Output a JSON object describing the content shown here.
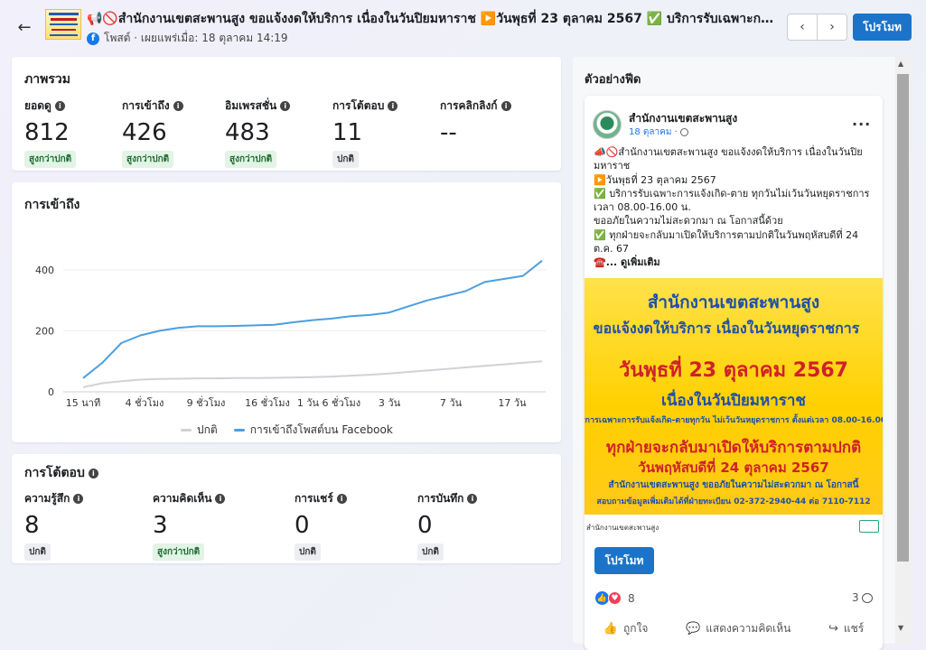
{
  "header": {
    "title": "📢🚫สำนักงานเขตสะพานสูง ขอแจ้งงดให้บริการ เนื่องในวันปิยมหาราช ▶️วันพุธที่ 23 ตุลาคม 2567 ✅ บริการรับเฉพาะการแจ้งเ...",
    "meta": "โพสต์ · เผยแพร่เมื่อ: 18 ตุลาคม 14:19",
    "prev_icon": "‹",
    "next_icon": "›",
    "promote_label": "โปรโมท"
  },
  "overview": {
    "title": "ภาพรวม",
    "metrics": [
      {
        "label": "ยอดดู",
        "value": "812",
        "badge": "สูงกว่าปกติ",
        "info": "i"
      },
      {
        "label": "การเข้าถึง",
        "value": "426",
        "badge": "สูงกว่าปกติ",
        "info": "i"
      },
      {
        "label": "อิมเพรสชั่น",
        "value": "483",
        "badge": "สูงกว่าปกติ",
        "info": "i"
      },
      {
        "label": "การโต้ตอบ",
        "value": "11",
        "badge": "ปกติ",
        "info": "i"
      },
      {
        "label": "การคลิกลิงก์",
        "value": "--",
        "info": "i"
      }
    ]
  },
  "reach": {
    "title": "การเข้าถึง"
  },
  "chart_data": {
    "type": "line",
    "title": "การเข้าถึง",
    "x_tick_labels": [
      "15 นาที",
      "4 ชั่วโมง",
      "9 ชั่วโมง",
      "16 ชั่วโมง",
      "1 วัน 6 ชั่วโมง",
      "3 วัน",
      "7 วัน",
      "17 วัน"
    ],
    "y_ticks": [
      "0",
      "200",
      "400"
    ],
    "ylim": [
      0,
      450
    ],
    "grid": true,
    "legend_placement": "bottom",
    "x": [
      0,
      1,
      2,
      3,
      4,
      5,
      6,
      7,
      8,
      9,
      10,
      11,
      12,
      13,
      14,
      15,
      16,
      17,
      18,
      19,
      20,
      21,
      22,
      23,
      24
    ],
    "series": [
      {
        "name": "ปกติ",
        "color": "#d0d2d6",
        "values": [
          15,
          28,
          35,
          40,
          42,
          43,
          44,
          44,
          45,
          45,
          46,
          47,
          48,
          50,
          53,
          56,
          60,
          65,
          70,
          75,
          80,
          85,
          90,
          95,
          100
        ]
      },
      {
        "name": "การเข้าถึงโพสต์บน Facebook",
        "color": "#4a9fe0",
        "values": [
          45,
          95,
          160,
          185,
          200,
          210,
          215,
          215,
          216,
          218,
          220,
          228,
          235,
          240,
          248,
          252,
          260,
          280,
          300,
          315,
          330,
          360,
          370,
          380,
          430
        ]
      }
    ]
  },
  "interactions": {
    "title": "การโต้ตอบ",
    "metrics": [
      {
        "label": "ความรู้สึก",
        "value": "8",
        "badge": "ปกติ",
        "info": "i"
      },
      {
        "label": "ความคิดเห็น",
        "value": "3",
        "badge": "สูงกว่าปกติ",
        "info": "i"
      },
      {
        "label": "การแชร์",
        "value": "0",
        "badge": "ปกติ",
        "info": "i"
      },
      {
        "label": "การบันทึก",
        "value": "0",
        "badge": "ปกติ",
        "info": "i"
      }
    ]
  },
  "preview": {
    "title": "ตัวอย่างฟีด",
    "page_name": "สำนักงานเขตสะพานสูง",
    "date": "18 ตุลาคม ·",
    "more_icon": "···",
    "body_lines": [
      "📣🚫สำนักงานเขตสะพานสูง ขอแจ้งงดให้บริการ เนื่องในวันปิยมหาราช",
      "▶️วันพุธที่ 23 ตุลาคม 2567",
      "✅ บริการรับเฉพาะการแจ้งเกิด-ตาย ทุกวันไม่เว้นวันหยุดราชการ เวลา 08.00-16.00 น.",
      "ขออภัยในความไม่สะดวกมา ณ โอกาสนี้ด้วย",
      "✅ ทุกฝ่ายจะกลับมาเปิดให้บริการตามปกติในวันพฤหัสบดีที่ 24 ต.ค. 67"
    ],
    "see_more": "☎️... ดูเพิ่มเติม",
    "poster": {
      "line1": "สำนักงานเขตสะพานสูง",
      "line2": "ขอแจ้งงดให้บริการ เนื่องในวันหยุดราชการ",
      "line3": "วันพุธที่ 23 ตุลาคม 2567",
      "line4": "เนื่องในวันปิยมหาราช",
      "line5": "บริการเฉพาะการรับแจ้งเกิด-ตายทุกวัน ไม่เว้นวันหยุดราชการ ตั้งแต่เวลา 08.00-16.00 น.",
      "line6": "ทุกฝ่ายจะกลับมาเปิดให้บริการตามปกติ",
      "line7": "วันพฤหัสบดีที่ 24 ตุลาคม 2567",
      "line8": "สำนักงานเขตสะพานสูง ขออภัยในความไม่สะดวกมา ณ โอกาสนี้",
      "line9": "สอบถามข้อมูลเพิ่มเติมได้ที่ฝ่ายทะเบียน 02-372-2940-44 ต่อ 7110-7112",
      "footer": "สำนักงานเขตสะพานสูง"
    },
    "promote_label": "โปรโมท",
    "reaction_count": "8",
    "comment_count": "3",
    "actions": {
      "like": "ถูกใจ",
      "comment": "แสดงความคิดเห็น",
      "share": "แชร์"
    }
  }
}
